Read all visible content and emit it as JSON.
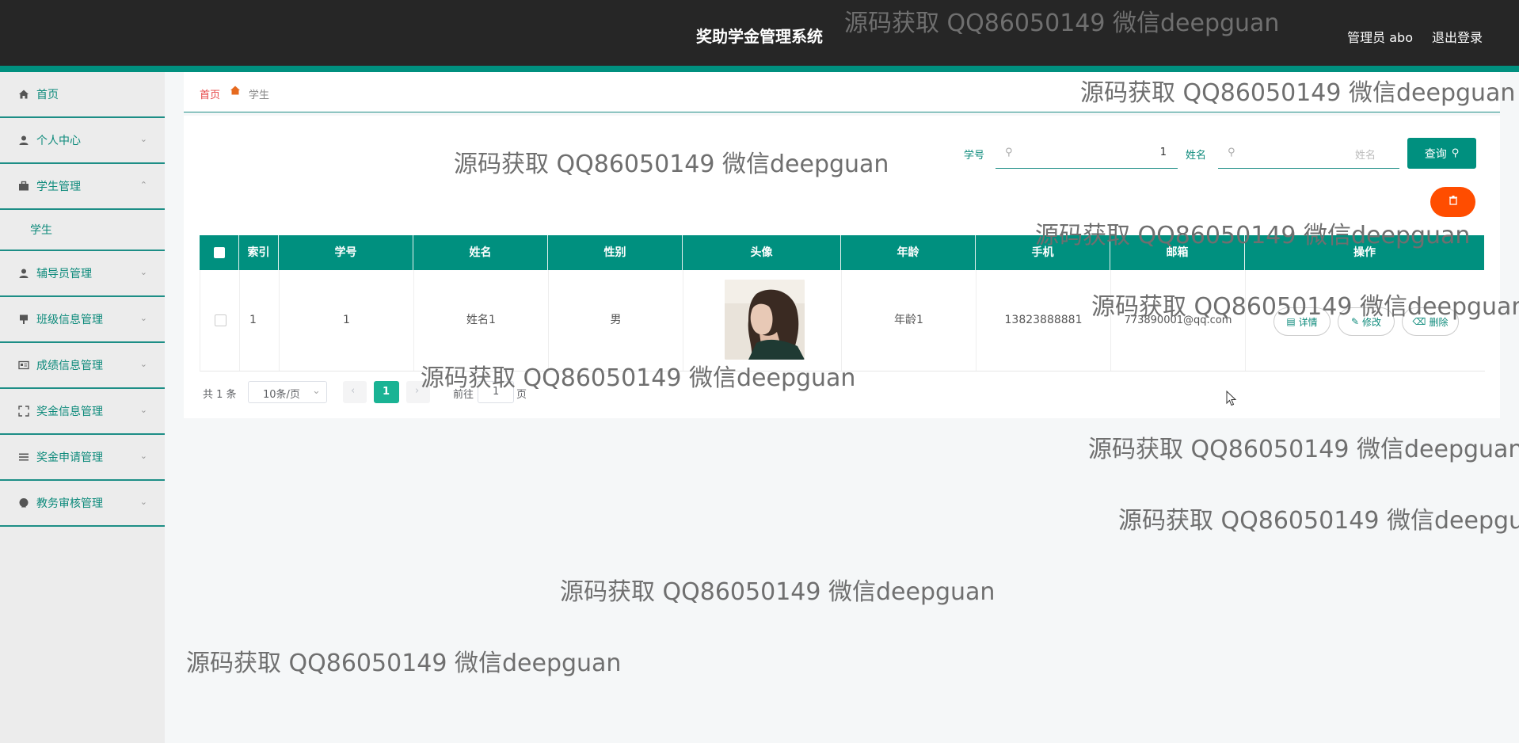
{
  "header": {
    "title": "奖助学金管理系统",
    "user": "管理员 abo",
    "logout": "退出登录"
  },
  "sidebar": {
    "items": [
      {
        "label": "首页",
        "icon": "home-icon"
      },
      {
        "label": "个人中心",
        "icon": "user-icon"
      },
      {
        "label": "学生管理",
        "icon": "briefcase-icon",
        "expanded": true
      },
      {
        "label": "学生",
        "sub": true
      },
      {
        "label": "辅导员管理",
        "icon": "user-icon"
      },
      {
        "label": "班级信息管理",
        "icon": "card-icon"
      },
      {
        "label": "成绩信息管理",
        "icon": "id-card-icon"
      },
      {
        "label": "奖金信息管理",
        "icon": "fullscreen-icon"
      },
      {
        "label": "奖金申请管理",
        "icon": "list-icon"
      },
      {
        "label": "教务审核管理",
        "icon": "shield-icon"
      }
    ]
  },
  "breadcrumb": {
    "home": "首页",
    "current": "学生"
  },
  "search": {
    "student_no_label": "学号",
    "student_no_value": "1",
    "name_label": "姓名",
    "name_placeholder": "姓名",
    "query_button": "查询"
  },
  "table": {
    "columns": [
      "索引",
      "学号",
      "姓名",
      "性别",
      "头像",
      "年龄",
      "手机",
      "邮箱",
      "操作"
    ],
    "rows": [
      {
        "index": "1",
        "student_no": "1",
        "name": "姓名1",
        "gender": "男",
        "age": "年龄1",
        "phone": "13823888881",
        "email": "773890001@qq.com"
      }
    ],
    "actions": {
      "detail": "详情",
      "edit": "修改",
      "delete": "删除"
    }
  },
  "pagination": {
    "total": "共 1 条",
    "page_size": "10条/页",
    "current_page": "1",
    "goto_prefix": "前往",
    "goto_value": "1",
    "goto_suffix": "页"
  },
  "watermark": {
    "text": "源码获取 QQ86050149 微信deepguan"
  },
  "colors": {
    "accent": "#00907f",
    "header_bg": "#262626",
    "danger": "#ff4d00"
  }
}
